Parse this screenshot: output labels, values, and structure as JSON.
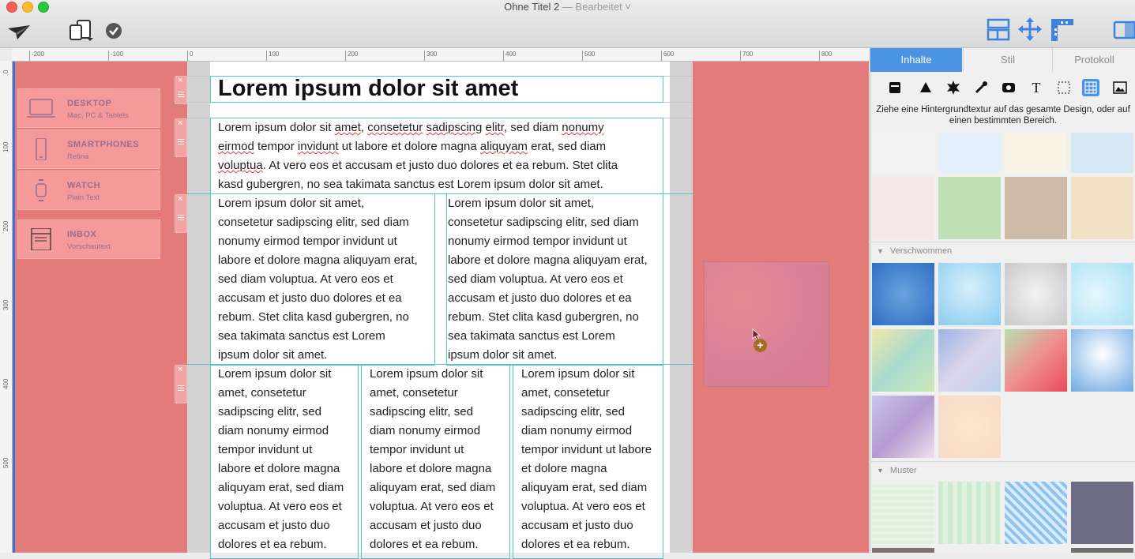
{
  "window": {
    "title": "Ohne Titel 2",
    "status": " — Bearbeitet ˅"
  },
  "ruler": {
    "h_ticks": [
      "-200",
      "-100",
      "0",
      "100",
      "200",
      "300",
      "400",
      "500",
      "600",
      "700",
      "800"
    ],
    "v_ticks": [
      "0",
      "100",
      "200",
      "300",
      "400",
      "500"
    ]
  },
  "devices": [
    {
      "title": "DESKTOP",
      "subtitle": "Mac, PC & Tablets",
      "icon": "laptop-icon"
    },
    {
      "title": "SMARTPHONES",
      "subtitle": "Retina",
      "icon": "smartphone-icon"
    },
    {
      "title": "WATCH",
      "subtitle": "Plain Text",
      "icon": "watch-icon"
    },
    {
      "title": "INBOX",
      "subtitle": "Vorschautext",
      "icon": "inbox-icon"
    }
  ],
  "document": {
    "heading": "Lorem ipsum dolor sit amet",
    "paragraph_full_lines": [
      [
        "Lorem ipsum dolor sit ",
        "amet",
        ", ",
        "consetetur",
        " ",
        "sadipscing",
        " ",
        "elitr",
        ", sed diam ",
        "nonumy"
      ],
      [
        "eirmod",
        " tempor ",
        "invidunt",
        " ut labore et dolore magna ",
        "aliquyam",
        " erat, sed diam"
      ],
      [
        "voluptua",
        ". At vero eos et accusam et justo duo dolores et ea rebum. Stet clita"
      ],
      [
        "kasd gubergren, no sea takimata sanctus est Lorem ipsum dolor sit amet."
      ]
    ],
    "two_col_lines": [
      "Lorem ipsum dolor sit amet,",
      "consetetur sadipscing elitr, sed diam",
      "nonumy eirmod tempor invidunt ut",
      "labore et dolore magna aliquyam erat,",
      "sed diam voluptua. At vero eos et",
      "accusam et justo duo dolores et ea",
      "rebum. Stet clita kasd gubergren, no",
      "sea takimata sanctus est Lorem",
      "ipsum dolor sit amet."
    ],
    "three_col_lines_a": [
      "Lorem ipsum dolor sit",
      "amet, consetetur",
      "sadipscing elitr, sed",
      "diam nonumy eirmod",
      "tempor invidunt ut",
      "labore et dolore magna",
      "aliquyam erat, sed diam",
      "voluptua. At vero eos et",
      "accusam et justo duo",
      "dolores et ea rebum."
    ],
    "three_col_lines_c": [
      "Lorem ipsum dolor sit",
      "amet, consetetur",
      "sadipscing elitr, sed",
      "diam nonumy eirmod",
      "tempor invidunt ut labore",
      "et dolore magna",
      "aliquyam erat, sed diam",
      "voluptua. At vero eos et",
      "accusam et justo duo",
      "dolores et ea rebum."
    ]
  },
  "panel": {
    "tabs": [
      "Inhalte",
      "Stil",
      "Protokoll"
    ],
    "hint": "Ziehe eine Hintergrundtextur auf das gesamte Design, oder auf einen bestimmten Bereich.",
    "sections": [
      "Verschwommen",
      "Muster"
    ]
  },
  "drop_badge": "+",
  "colors": {
    "canvas": "#e37b7b",
    "accent": "#4b93e4",
    "guide": "#57c3cc",
    "device_card": "#f49a9a"
  }
}
